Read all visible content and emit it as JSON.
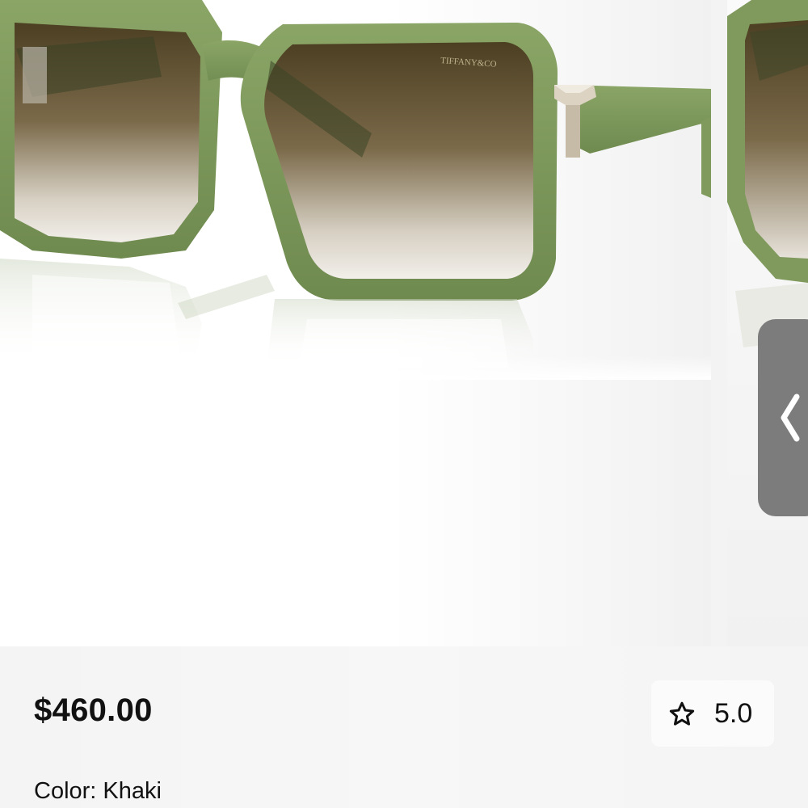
{
  "product": {
    "price": "$460.00",
    "rating": "5.0",
    "color_label": "Color:",
    "color_value": "Khaki",
    "image_alt": "Khaki green square sunglasses with gradient brown lenses",
    "frame_color": "#7f9a5c",
    "lens_color": "#5a4a2a",
    "hinge_color": "#d8cfbf",
    "lens_brand_text": "TIFFANY&CO"
  },
  "carousel": {
    "prev_icon": "chevron-left-icon"
  },
  "rating_icon": "star-outline-icon"
}
